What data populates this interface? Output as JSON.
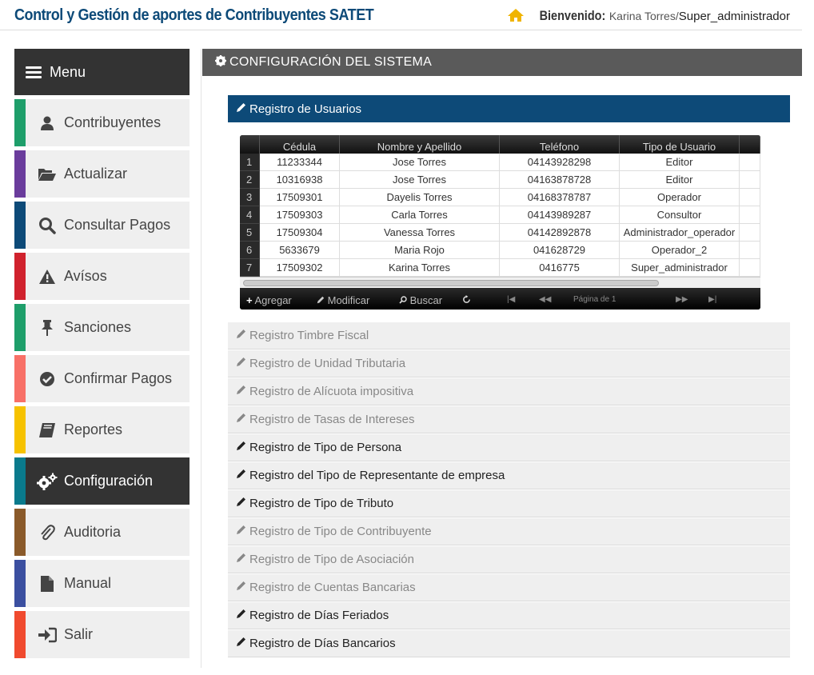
{
  "header": {
    "title": "Control y Gestión de aportes de Contribuyentes SATET",
    "welcome_label": "Bienvenido:",
    "user_name": "Karina Torres/",
    "user_role": "Super_administrador"
  },
  "sidebar": {
    "menu_label": "Menu",
    "items": [
      {
        "label": "Contribuyentes",
        "icon": "user-icon",
        "color": "#1e9e6a"
      },
      {
        "label": "Actualizar",
        "icon": "folder-open-icon",
        "color": "#6a3c9c"
      },
      {
        "label": "Consultar Pagos",
        "icon": "search-icon",
        "color": "#0d4a78"
      },
      {
        "label": "Avísos",
        "icon": "warning-icon",
        "color": "#d0222d"
      },
      {
        "label": "Sanciones",
        "icon": "pushpin-icon",
        "color": "#1e9e6a"
      },
      {
        "label": "Confirmar Pagos",
        "icon": "check-circle-icon",
        "color": "#f87067"
      },
      {
        "label": "Reportes",
        "icon": "book-icon",
        "color": "#f6c200"
      },
      {
        "label": "Configuración",
        "icon": "gears-icon",
        "color": "#0a7a8c"
      },
      {
        "label": "Auditoria",
        "icon": "paperclip-icon",
        "color": "#8a5a2a"
      },
      {
        "label": "Manual",
        "icon": "file-icon",
        "color": "#3b4fa0"
      },
      {
        "label": "Salir",
        "icon": "sign-in-icon",
        "color": "#f04a2e"
      }
    ]
  },
  "main": {
    "section_title": "CONFIGURACIÓN DEL SISTEMA",
    "active_panel": "Registro de Usuarios",
    "grid": {
      "columns": [
        "Cédula",
        "Nombre y Apellido",
        "Teléfono",
        "Tipo de Usuario"
      ],
      "rows": [
        {
          "n": "1",
          "cedula": "11233344",
          "nombre": "Jose Torres",
          "telefono": "04143928298",
          "tipo": "Editor"
        },
        {
          "n": "2",
          "cedula": "10316938",
          "nombre": "Jose Torres",
          "telefono": "04163878728",
          "tipo": "Editor"
        },
        {
          "n": "3",
          "cedula": "17509301",
          "nombre": "Dayelis Torres",
          "telefono": "04168378787",
          "tipo": "Operador"
        },
        {
          "n": "4",
          "cedula": "17509303",
          "nombre": "Carla Torres",
          "telefono": "04143989287",
          "tipo": "Consultor"
        },
        {
          "n": "5",
          "cedula": "17509304",
          "nombre": "Vanessa Torres",
          "telefono": "04142892878",
          "tipo": "Administrador_operador"
        },
        {
          "n": "6",
          "cedula": "5633679",
          "nombre": "Maria Rojo",
          "telefono": "041628729",
          "tipo": "Operador_2"
        },
        {
          "n": "7",
          "cedula": "17509302",
          "nombre": "Karina Torres",
          "telefono": "0416775",
          "tipo": "Super_administrador"
        }
      ],
      "pager": {
        "add": "Agregar",
        "edit": "Modificar",
        "search": "Buscar",
        "first": "|◀",
        "prev": "◀◀",
        "page_text": "Página de 1",
        "next": "▶▶",
        "last": "▶|"
      }
    },
    "panels": [
      {
        "label": "Registro Timbre Fiscal",
        "dim": true
      },
      {
        "label": "Registro de Unidad Tributaria",
        "dim": true
      },
      {
        "label": "Registro de Alícuota impositiva",
        "dim": true
      },
      {
        "label": "Registro de Tasas de Intereses",
        "dim": true
      },
      {
        "label": "Registro de Tipo de Persona",
        "dim": false
      },
      {
        "label": "Registro del Tipo de Representante de empresa",
        "dim": false
      },
      {
        "label": "Registro de Tipo de Tributo",
        "dim": false
      },
      {
        "label": "Registro de Tipo de Contribuyente",
        "dim": true
      },
      {
        "label": "Registro de Tipo de Asociación",
        "dim": true
      },
      {
        "label": "Registro de Cuentas Bancarias",
        "dim": true
      },
      {
        "label": "Registro de Días Feriados",
        "dim": false
      },
      {
        "label": "Registro de Días Bancarios",
        "dim": false
      }
    ]
  },
  "colors": {
    "brand": "#0d4a78",
    "menu_dark": "#333333",
    "section_header": "#5a5a5a",
    "home_icon": "#f0b400"
  }
}
